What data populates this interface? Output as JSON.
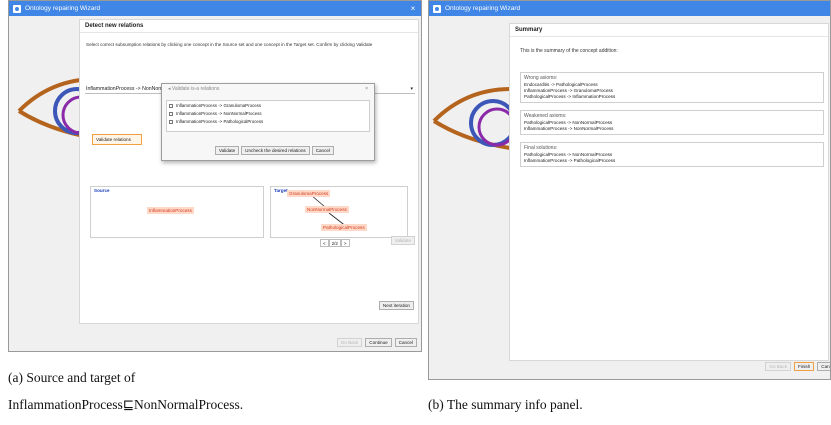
{
  "left_window": {
    "title": "Ontology repairing Wizard",
    "close": "×",
    "heading": "Detect new relations",
    "instruction": "Select correct subsumption relations by clicking one concept in the Source set and one concept in the Target set. Confirm by clicking Validate",
    "combo_value": "InflammationProcess -> NonNormalProcess",
    "combo_arrow": "▾",
    "validate_relations_label": "Validate relations",
    "popup": {
      "title": "Validate is-a relations",
      "close": "×",
      "items": [
        "InflammationProcess -> GranulomaProcess",
        "InflammationProcess -> NonNormalProcess",
        "InflammationProcess -> PathologicalProcess"
      ],
      "buttons": {
        "validate": "Validate",
        "uncheck": "Uncheck the desired relations",
        "cancel": "Cancel"
      }
    },
    "source_label": "Source",
    "target_label": "Target",
    "source_node": "InflammationProcess",
    "target_nodes": [
      "GranulomaProcess",
      "NonNormalProcess",
      "PathologicalProcess"
    ],
    "pager": {
      "prev": "<",
      "page": "2/2",
      "next": ">"
    },
    "right_validate": "Validate",
    "next_iteration": "Next iteration",
    "buttons": {
      "go_back": "Go Back",
      "continue": "Continue",
      "cancel": "Cancel"
    }
  },
  "right_window": {
    "title": "Ontology repairing Wizard",
    "heading": "Summary",
    "summary_line": "This is the summary of the concept addition:",
    "sections": [
      {
        "title": "Wrong axioms:",
        "items": [
          "Endocarditis -> PathologicalProcess",
          "InflammationProcess -> GranulomaProcess",
          "PathologicalProcess -> InflammationProcess"
        ]
      },
      {
        "title": "Weakened axioms:",
        "items": [
          "PathologicalProcess -> NonNormalProcess",
          "InflammationProcess -> NonNormalProcess"
        ]
      },
      {
        "title": "Final solutions:",
        "items": [
          "PathologicalProcess -> NonNormalProcess",
          "InflammationProcess -> PathologicalProcess"
        ]
      }
    ],
    "buttons": {
      "go_back": "Go Back",
      "finish": "Finish",
      "cancel": "Canc"
    }
  },
  "captions": {
    "a_line1": "(a)      Source       and       target       of",
    "a_line2": "InflammationProcess⊑NonNormalProcess.",
    "b": "(b) The summary info panel."
  },
  "colors": {
    "titlebar": "#3f86e6",
    "node_bg": "#ffd9c8",
    "node_text": "#d23a1e",
    "accent": "#f0a040"
  }
}
